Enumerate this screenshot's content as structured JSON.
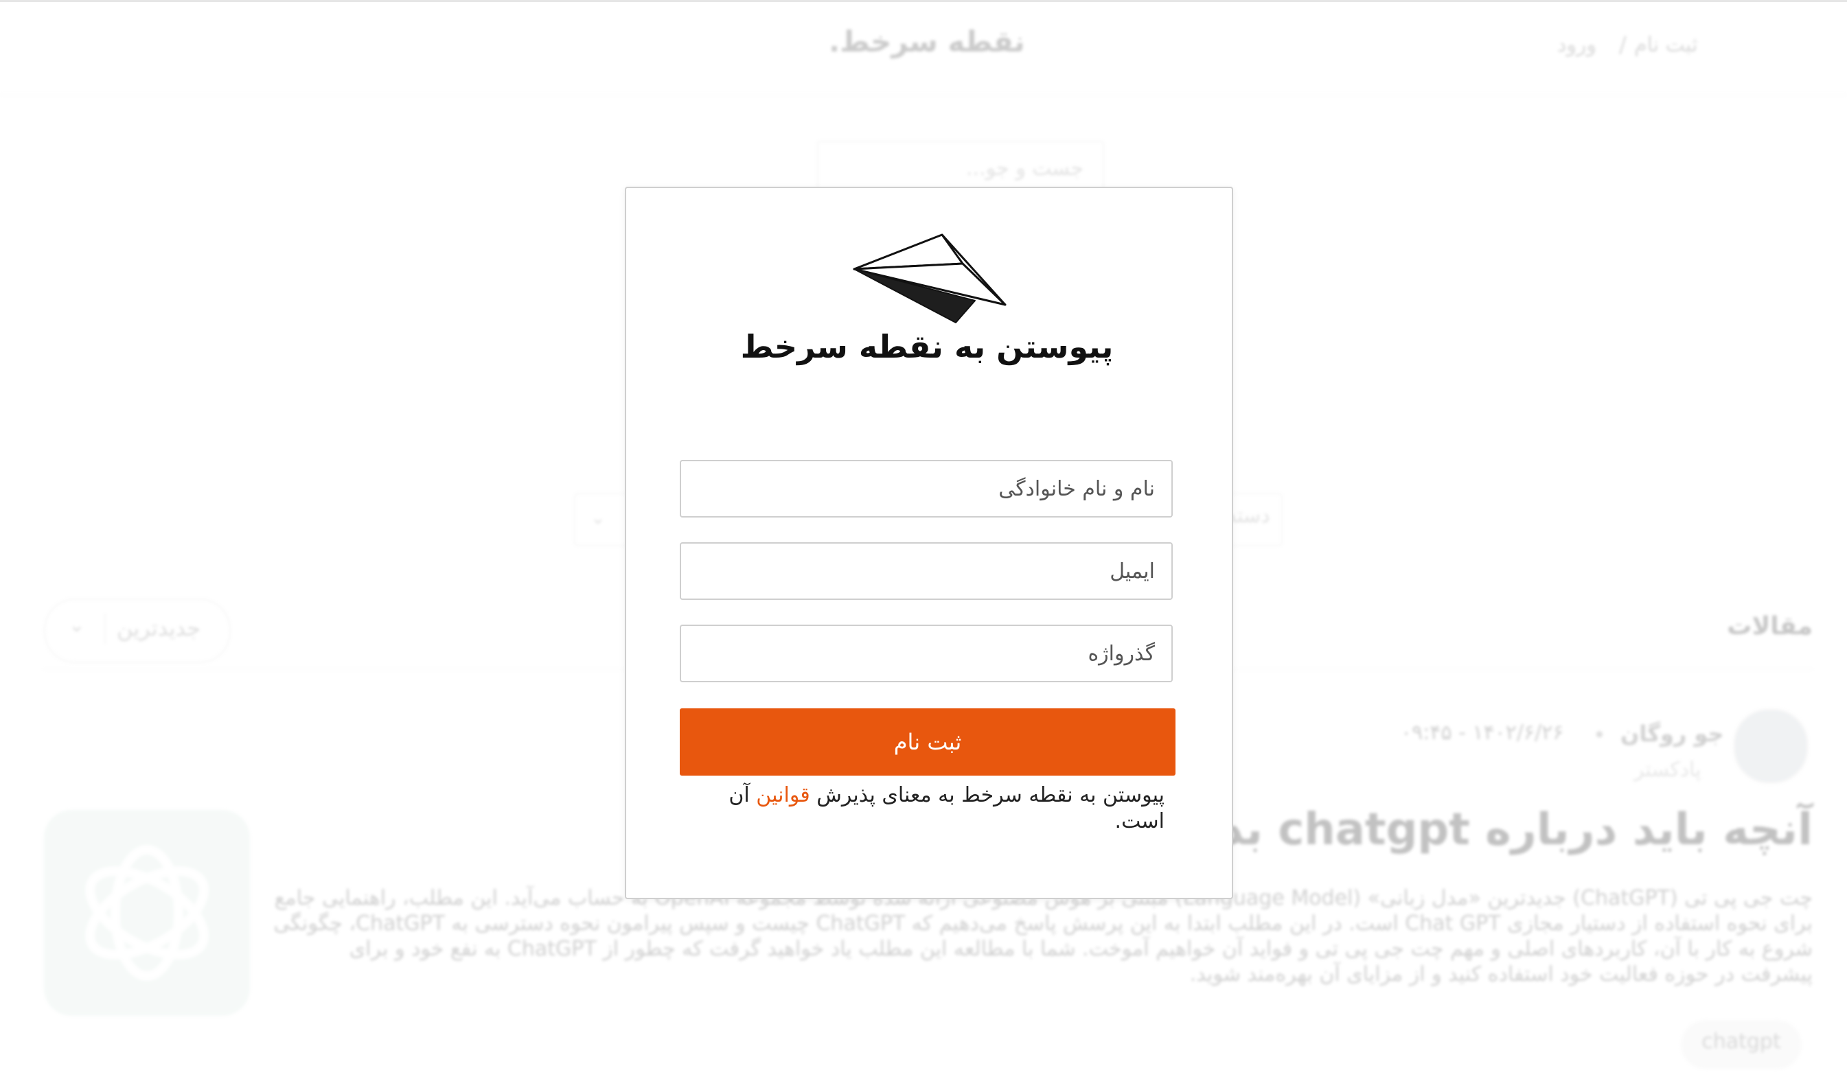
{
  "header": {
    "logo_text": "نقطه سرخط.",
    "signup_label": "ثبت نام",
    "separator": "/",
    "login_label": "ورود"
  },
  "search": {
    "placeholder": "جست و جو..."
  },
  "filter": {
    "label": "دسته"
  },
  "articles": {
    "section_title": "مقالات",
    "sort_label": "جدیدترین",
    "post": {
      "author": "جو روگان",
      "role": "پادکستر",
      "date": "۱۴۰۲/۶/۲۶ - ۰۹:۴۵",
      "title": "آنچه باید درباره chatgpt بدانید",
      "excerpt": "چت جی پی تی (ChatGPT) جدیدترین «مدل زبانی» (Language Model) مبتنی بر هوش مصنوعی ارائه شده توسط مجموعه OpenAI به حساب می‌آید. این مطلب، راهنمایی جامع برای نحوه استفاده از دستیار مجازی Chat GPT است. در این مطلب ابتدا به این پرسش پاسخ می‌دهیم که ChatGPT چیست و سپس پیرامون نحوه دسترسی به ChatGPT، چگونگی شروع به کار با آن، کاربردهای اصلی و مهم چت جی پی تی و فواید آن خواهیم آموخت. شما با مطالعه این مطلب یاد خواهید گرفت که چطور از ChatGPT به نفع خود و برای پیشرفت در حوزه فعالیت خود استفاده کنید و از مزایای آن بهره‌مند شوید.",
      "tag": "chatgpt"
    }
  },
  "modal": {
    "title": "پیوستن به نقطه سرخط",
    "name_placeholder": "نام و نام خانوادگی",
    "email_placeholder": "ایمیل",
    "password_placeholder": "گذرواژه",
    "submit_label": "ثبت نام",
    "terms_prefix": "پیوستن به نقطه سرخط به معنای پذیرش ",
    "terms_link": "قوانین",
    "terms_suffix": " آن است."
  },
  "colors": {
    "accent": "#e8570e",
    "thumb_bg": "#dfece7"
  },
  "icons": {
    "logo": "paper-plane-icon",
    "chevron": "chevron-down-icon",
    "thumb": "openai-logo-icon"
  }
}
